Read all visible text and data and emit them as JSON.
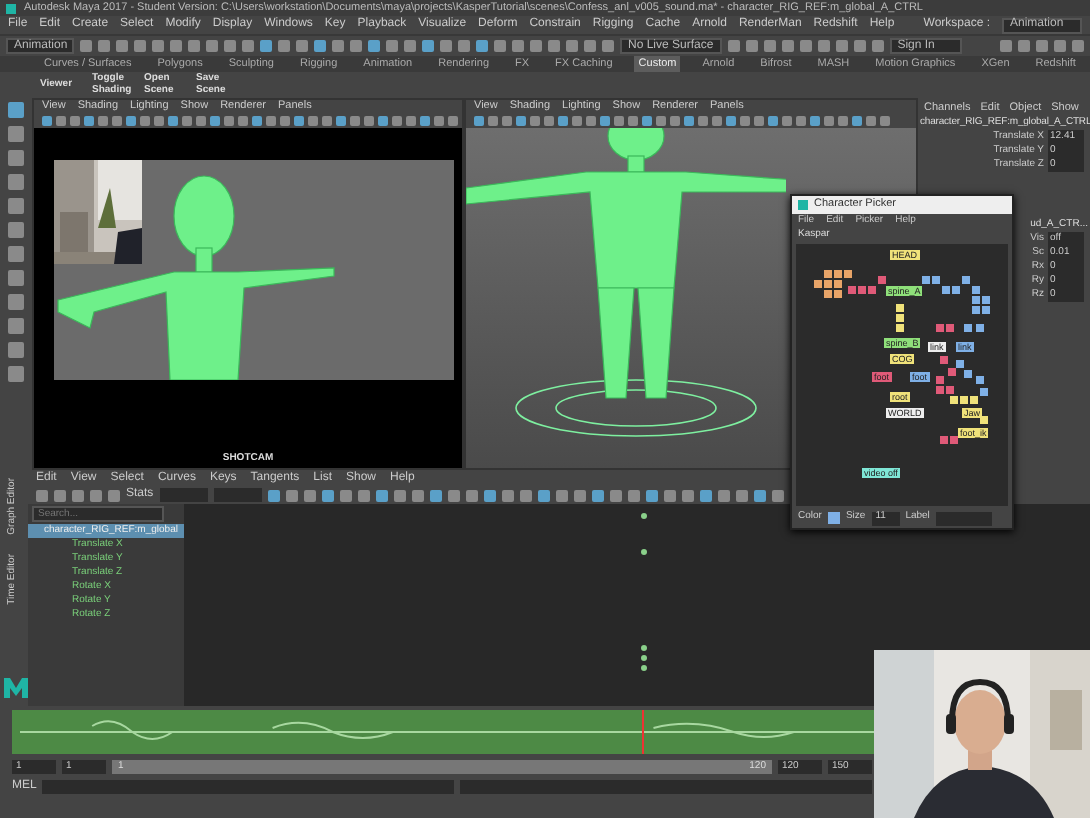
{
  "window": {
    "title": "Autodesk Maya 2017 - Student Version: C:\\Users\\workstation\\Documents\\maya\\projects\\KasperTutorial\\scenes\\Confess_anl_v005_sound.ma*  -  character_RIG_REF:m_global_A_CTRL"
  },
  "menu": [
    "File",
    "Edit",
    "Create",
    "Select",
    "Modify",
    "Display",
    "Windows",
    "Key",
    "Playback",
    "Visualize",
    "Deform",
    "Constrain",
    "Rigging",
    "Cache",
    "Arnold",
    "RenderMan",
    "Redshift",
    "Help"
  ],
  "workspace": {
    "label": "Workspace :",
    "value": "Animation"
  },
  "toolbar": {
    "menu_set": "Animation",
    "live_surface": "No Live Surface",
    "sign_in": "Sign In"
  },
  "shelf": {
    "tabs": [
      {
        "label": "Curves / Surfaces",
        "selected": false
      },
      {
        "label": "Polygons",
        "selected": false
      },
      {
        "label": "Sculpting",
        "selected": false
      },
      {
        "label": "Rigging",
        "selected": false
      },
      {
        "label": "Animation",
        "selected": false
      },
      {
        "label": "Rendering",
        "selected": false
      },
      {
        "label": "FX",
        "selected": false
      },
      {
        "label": "FX Caching",
        "selected": false
      },
      {
        "label": "Custom",
        "selected": true
      },
      {
        "label": "Arnold",
        "selected": false
      },
      {
        "label": "Bifrost",
        "selected": false
      },
      {
        "label": "MASH",
        "selected": false
      },
      {
        "label": "Motion Graphics",
        "selected": false
      },
      {
        "label": "XGen",
        "selected": false
      },
      {
        "label": "Redshift",
        "selected": false
      }
    ],
    "buttons": [
      "Viewer",
      "Toggle Shading",
      "Open Scene",
      "Save Scene"
    ]
  },
  "viewports": [
    {
      "menu": [
        "View",
        "Shading",
        "Lighting",
        "Show",
        "Renderer",
        "Panels"
      ],
      "camera": "SHOTCAM"
    },
    {
      "menu": [
        "View",
        "Shading",
        "Lighting",
        "Show",
        "Renderer",
        "Panels"
      ]
    }
  ],
  "channel_box": {
    "menu": [
      "Channels",
      "Edit",
      "Object",
      "Show"
    ],
    "node": "character_RIG_REF:m_global_A_CTRL",
    "rows": [
      {
        "name": "Translate X",
        "value": "12.41"
      },
      {
        "name": "Translate Y",
        "value": "0"
      },
      {
        "name": "Translate Z",
        "value": "0"
      }
    ],
    "shape": "ud_A_CTR...",
    "shape_rows": [
      {
        "name": "Vis",
        "value": "off"
      },
      {
        "name": "Sc",
        "value": "0.01"
      },
      {
        "name": "Rx",
        "value": "0"
      },
      {
        "name": "Ry",
        "value": "0"
      },
      {
        "name": "Rz",
        "value": "0"
      }
    ]
  },
  "character_picker": {
    "title": "Character Picker",
    "menu": [
      "File",
      "Edit",
      "Picker",
      "Help"
    ],
    "tab": "Kaspar",
    "controls": [
      {
        "label": "HEAD",
        "color": "#f0e27a"
      },
      {
        "label": "spine_A",
        "color": "#8fe07a"
      },
      {
        "label": "spine_B",
        "color": "#8fe07a"
      },
      {
        "label": "COG",
        "color": "#f0e27a"
      },
      {
        "label": "foot",
        "color": "#e05a78"
      },
      {
        "label": "foot",
        "color": "#7fb0e6"
      },
      {
        "label": "root",
        "color": "#f0e27a"
      },
      {
        "label": "WORLD",
        "color": "#eeeeee"
      },
      {
        "label": "link",
        "color": "#eeeeee"
      },
      {
        "label": "link",
        "color": "#7fb0e6"
      },
      {
        "label": "Jaw",
        "color": "#f0e27a"
      },
      {
        "label": "foot_ik",
        "color": "#f0e27a"
      },
      {
        "label": "video off",
        "color": "#7fe6d6"
      }
    ],
    "footer": {
      "color_label": "Color",
      "size_label": "Size",
      "size": "11",
      "label_label": "Label"
    }
  },
  "graph_editor": {
    "tabs": [
      "Graph Editor",
      "Time Editor"
    ],
    "menu": [
      "Edit",
      "View",
      "Select",
      "Curves",
      "Keys",
      "Tangents",
      "List",
      "Show",
      "Help"
    ],
    "stats_label": "Stats",
    "search_placeholder": "Search...",
    "outliner": [
      {
        "label": "character_RIG_REF:m_global",
        "selected": true,
        "children": [
          {
            "label": "Translate X",
            "selected": false
          },
          {
            "label": "Translate Y",
            "selected": false
          },
          {
            "label": "Translate Z",
            "selected": false
          },
          {
            "label": "Rotate X",
            "selected": false
          },
          {
            "label": "Rotate Y",
            "selected": false
          },
          {
            "label": "Rotate Z",
            "selected": false
          }
        ]
      }
    ]
  },
  "time_slider": {
    "level": 0.73
  },
  "range_slider": {
    "start": "1",
    "inner_start": "1",
    "slider_start": "1",
    "slider_end": "120",
    "inner_end": "120",
    "end": "150",
    "level": 1
  },
  "command_line": {
    "language": "MEL"
  }
}
